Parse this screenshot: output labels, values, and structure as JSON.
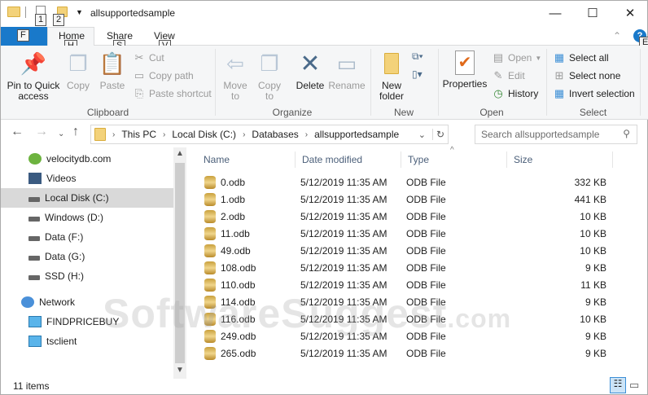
{
  "window": {
    "title": "allsupportedsample",
    "keytips": {
      "qa1": "1",
      "qa2": "2",
      "file": "F",
      "home": "H",
      "share": "S",
      "view": "V",
      "help": "E"
    }
  },
  "tabs": {
    "file": "F",
    "home": "Home",
    "share": "Share",
    "view": "View"
  },
  "ribbon": {
    "clipboard": {
      "label": "Clipboard",
      "pin": "Pin to Quick access",
      "copy": "Copy",
      "paste": "Paste",
      "cut": "Cut",
      "copy_path": "Copy path",
      "paste_shortcut": "Paste shortcut"
    },
    "organize": {
      "label": "Organize",
      "move_to": "Move to",
      "copy_to": "Copy to",
      "delete": "Delete",
      "rename": "Rename"
    },
    "new": {
      "label": "New",
      "new_folder": "New folder"
    },
    "open": {
      "label": "Open",
      "properties": "Properties",
      "open": "Open",
      "edit": "Edit",
      "history": "History"
    },
    "select": {
      "label": "Select",
      "select_all": "Select all",
      "select_none": "Select none",
      "invert": "Invert selection"
    }
  },
  "address": {
    "crumbs": [
      "This PC",
      "Local Disk (C:)",
      "Databases",
      "allsupportedsample"
    ],
    "search_placeholder": "Search allsupportedsample"
  },
  "sidebar": {
    "items": [
      "velocitydb.com",
      "Videos",
      "Local Disk (C:)",
      "Windows (D:)",
      "Data (F:)",
      "Data (G:)",
      "SSD (H:)",
      "Network",
      "FINDPRICEBUY",
      "tsclient"
    ]
  },
  "columns": [
    "Name",
    "Date modified",
    "Type",
    "Size"
  ],
  "files": [
    {
      "name": "0.odb",
      "date": "5/12/2019 11:35 AM",
      "type": "ODB File",
      "size": "332 KB"
    },
    {
      "name": "1.odb",
      "date": "5/12/2019 11:35 AM",
      "type": "ODB File",
      "size": "441 KB"
    },
    {
      "name": "2.odb",
      "date": "5/12/2019 11:35 AM",
      "type": "ODB File",
      "size": "10 KB"
    },
    {
      "name": "11.odb",
      "date": "5/12/2019 11:35 AM",
      "type": "ODB File",
      "size": "10 KB"
    },
    {
      "name": "49.odb",
      "date": "5/12/2019 11:35 AM",
      "type": "ODB File",
      "size": "10 KB"
    },
    {
      "name": "108.odb",
      "date": "5/12/2019 11:35 AM",
      "type": "ODB File",
      "size": "9 KB"
    },
    {
      "name": "110.odb",
      "date": "5/12/2019 11:35 AM",
      "type": "ODB File",
      "size": "11 KB"
    },
    {
      "name": "114.odb",
      "date": "5/12/2019 11:35 AM",
      "type": "ODB File",
      "size": "9 KB"
    },
    {
      "name": "116.odb",
      "date": "5/12/2019 11:35 AM",
      "type": "ODB File",
      "size": "10 KB"
    },
    {
      "name": "249.odb",
      "date": "5/12/2019 11:35 AM",
      "type": "ODB File",
      "size": "9 KB"
    },
    {
      "name": "265.odb",
      "date": "5/12/2019 11:35 AM",
      "type": "ODB File",
      "size": "9 KB"
    }
  ],
  "status": {
    "count": "11 items"
  },
  "watermark": {
    "main": "SoftwareSuggest",
    "suffix": ".com"
  }
}
